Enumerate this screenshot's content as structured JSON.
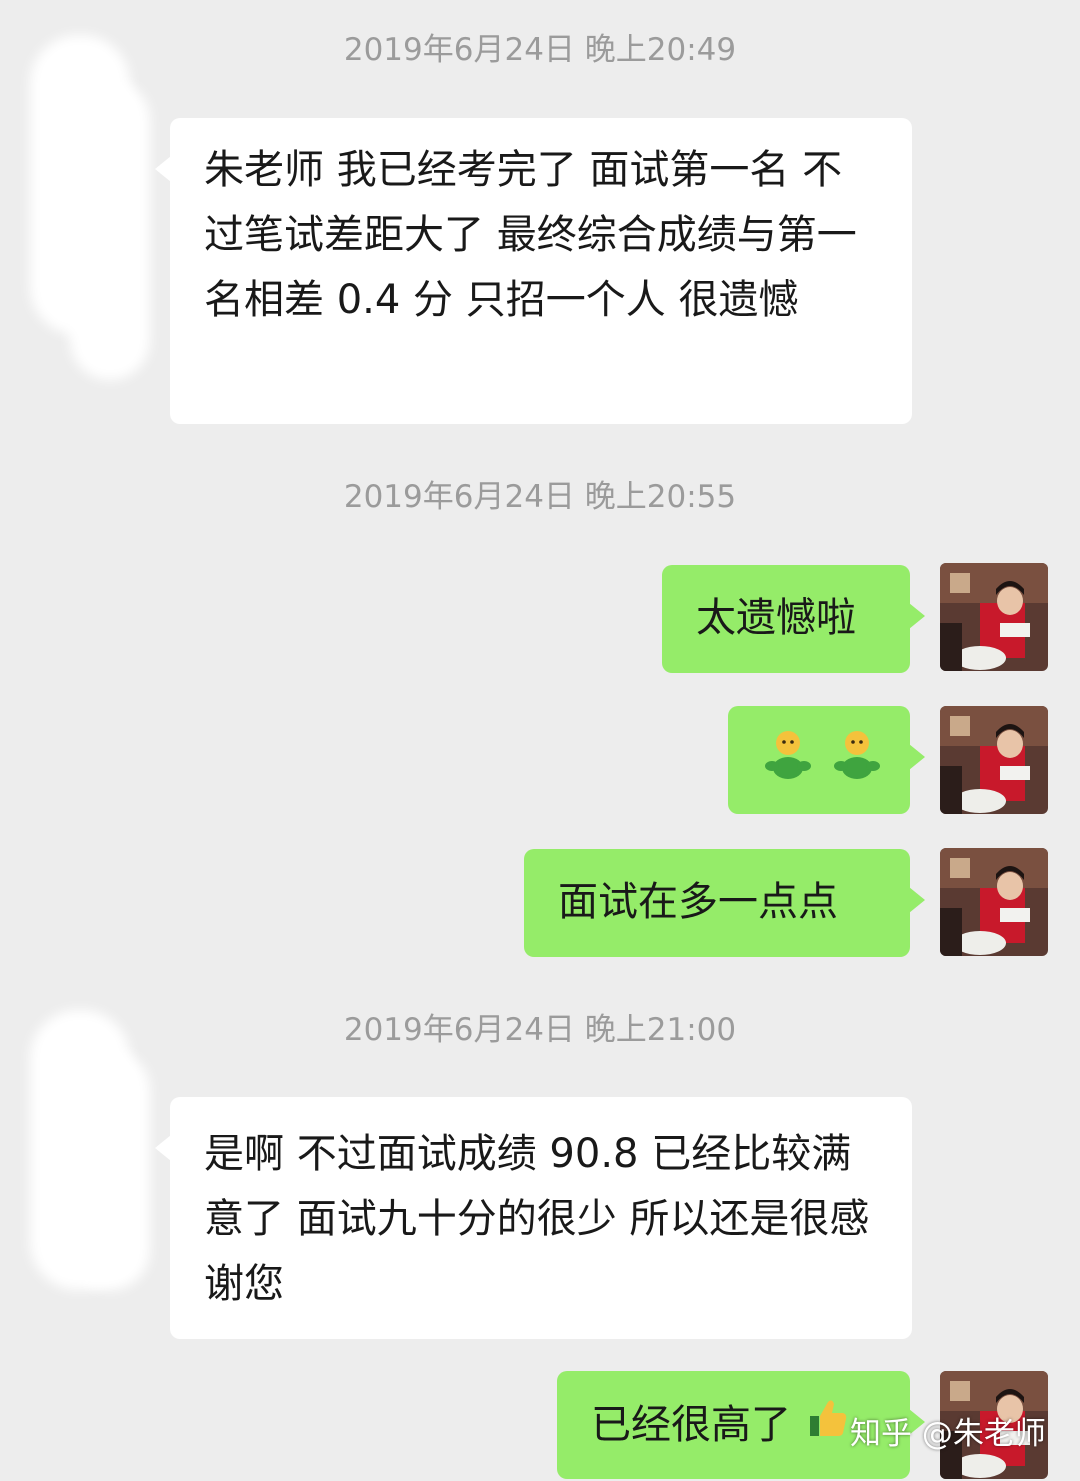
{
  "timestamps": [
    "2019年6月24日 晚上20:49",
    "2019年6月24日 晚上20:55",
    "2019年6月24日 晚上21:00"
  ],
  "messages": [
    {
      "side": "left",
      "text": "朱老师  我已经考完了  面试第一名  不过笔试差距大了  最终综合成绩与第一名相差 0.4 分  只招一个人  很遗憾"
    },
    {
      "side": "right",
      "text": "太遗憾啦"
    },
    {
      "side": "right",
      "emoji": [
        "person-emoji",
        "person-emoji"
      ]
    },
    {
      "side": "right",
      "text": "面试在多一点点"
    },
    {
      "side": "left",
      "text": "是啊  不过面试成绩 90.8  已经比较满意了  面试九十分的很少  所以还是很感谢您"
    },
    {
      "side": "right",
      "text": "已经很高了",
      "emoji": [
        "thumbs-up-emoji"
      ]
    }
  ],
  "watermark": "知乎 @朱老师",
  "colors": {
    "background": "#ededed",
    "incoming_bubble": "#ffffff",
    "outgoing_bubble": "#95ec69",
    "timestamp": "#9b9b9b",
    "text": "#191919"
  }
}
